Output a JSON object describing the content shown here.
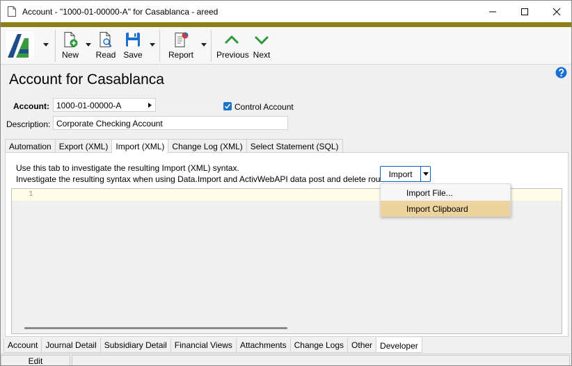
{
  "window": {
    "title": "Account - \"1000-01-00000-A\" for Casablanca - areed"
  },
  "colors": {
    "accent_strip": "#8b8016",
    "nav_arrows": "#2e9a3c",
    "selection_highlight": "#ecd29c",
    "checkbox": "#1a73c5",
    "help": "#1a6fd0"
  },
  "toolbar": {
    "new_label": "New",
    "read_label": "Read",
    "save_label": "Save",
    "report_label": "Report",
    "previous_label": "Previous",
    "next_label": "Next"
  },
  "page": {
    "title": "Account for Casablanca"
  },
  "form": {
    "account_label": "Account:",
    "account_value": "1000-01-00000-A",
    "control_account_label": "Control Account",
    "control_account_checked": true,
    "description_label": "Description:",
    "description_value": "Corporate Checking Account"
  },
  "tabs": [
    {
      "label": "Automation",
      "active": false
    },
    {
      "label": "Export (XML)",
      "active": false
    },
    {
      "label": "Import (XML)",
      "active": true
    },
    {
      "label": "Change Log (XML)",
      "active": false
    },
    {
      "label": "Select Statement (SQL)",
      "active": false
    }
  ],
  "import_tab": {
    "instruction_1": "Use this tab to investigate the resulting Import (XML) syntax.",
    "instruction_2": "Investigate the resulting syntax when using Data.Import and ActivWebAPI data post and delete routes.",
    "import_button_label": "Import",
    "menu": [
      {
        "label": "Import File...",
        "highlighted": false
      },
      {
        "label": "Import Clipboard",
        "highlighted": true
      }
    ],
    "editor_line_number": "1"
  },
  "bottom_tabs": [
    {
      "label": "Account",
      "active": false
    },
    {
      "label": "Journal Detail",
      "active": false
    },
    {
      "label": "Subsidiary Detail",
      "active": false
    },
    {
      "label": "Financial Views",
      "active": false
    },
    {
      "label": "Attachments",
      "active": false
    },
    {
      "label": "Change Logs",
      "active": false
    },
    {
      "label": "Other",
      "active": false
    },
    {
      "label": "Developer",
      "active": true
    }
  ],
  "status": {
    "mode": "Edit"
  }
}
